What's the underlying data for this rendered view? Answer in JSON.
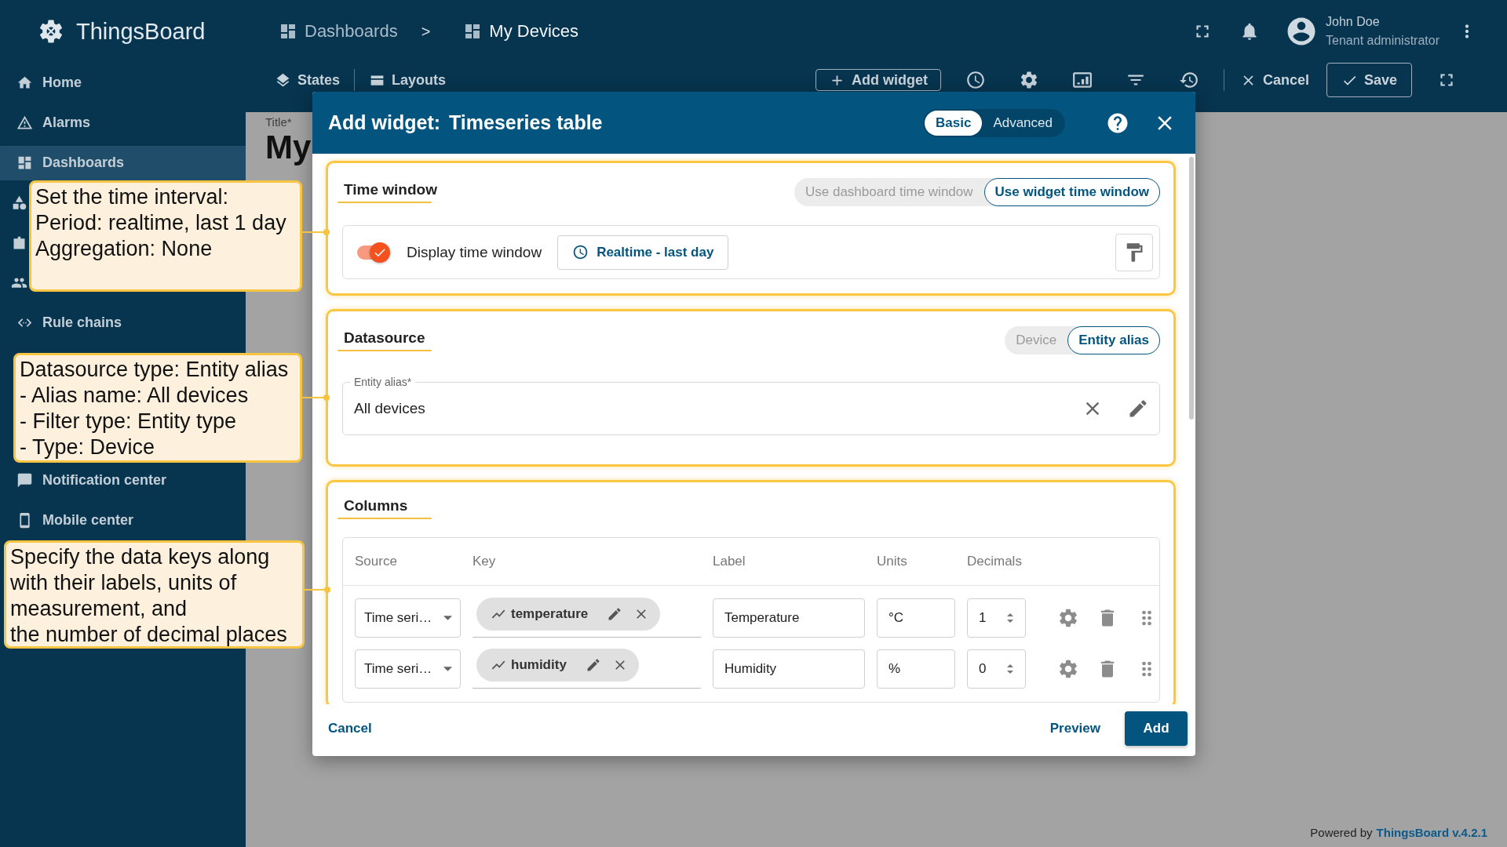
{
  "header": {
    "logo": "ThingsBoard",
    "breadcrumb": [
      {
        "label": "Dashboards"
      },
      {
        "label": "My Devices"
      }
    ],
    "separator": ">",
    "user": {
      "name": "John Doe",
      "role": "Tenant administrator"
    }
  },
  "sidebar": {
    "items": [
      {
        "label": "Home",
        "selected": false
      },
      {
        "label": "Alarms",
        "selected": false
      },
      {
        "label": "Dashboards",
        "selected": true
      },
      {
        "selected": false
      },
      {
        "selected": false
      },
      {
        "selected": false
      },
      {
        "label": "Rule chains",
        "selected": false
      },
      {
        "label": "Notification center",
        "selected": false
      },
      {
        "label": "Mobile center",
        "selected": false
      }
    ]
  },
  "toolbar": {
    "states": "States",
    "layouts": "Layouts",
    "add_widget": "Add widget",
    "cancel": "Cancel",
    "save": "Save"
  },
  "dashboard": {
    "title_label": "Title*",
    "title_value": "My"
  },
  "dialog": {
    "title": "Add widget:",
    "widget": "Timeseries table",
    "modes": [
      {
        "label": "Basic",
        "selected": true
      },
      {
        "label": "Advanced",
        "selected": false
      }
    ],
    "time_window": {
      "title": "Time window",
      "options": [
        {
          "label": "Use dashboard time window",
          "selected": false
        },
        {
          "label": "Use widget time window",
          "selected": true
        }
      ],
      "display": {
        "label": "Display time window",
        "on": true
      },
      "interval": "Realtime - last day"
    },
    "datasource": {
      "title": "Datasource",
      "options": [
        {
          "label": "Device",
          "selected": false
        },
        {
          "label": "Entity alias",
          "selected": true
        }
      ],
      "field": {
        "label": "Entity alias*",
        "value": "All devices"
      }
    },
    "columns": {
      "title": "Columns",
      "headers": [
        "Source",
        "Key",
        "Label",
        "Units",
        "Decimals"
      ],
      "rows": [
        {
          "source": "Time seri…",
          "key": "temperature",
          "label": "Temperature",
          "units": "°C",
          "decimals": "1"
        },
        {
          "source": "Time seri…",
          "key": "humidity",
          "label": "Humidity",
          "units": "%",
          "decimals": "0"
        }
      ]
    },
    "cancel": "Cancel",
    "preview": "Preview",
    "add": "Add"
  },
  "callouts": [
    {
      "text": "Set the time interval:\nPeriod: realtime, last 1 day\nAggregation: None"
    },
    {
      "text": "Datasource type: Entity alias\n- Alias name: All devices\n- Filter type: Entity type\n- Type: Device"
    },
    {
      "text": "Specify the data keys along\nwith their labels, units of\nmeasurement, and\nthe number of decimal places"
    }
  ],
  "footer": {
    "powered_by": "Powered by",
    "link": "ThingsBoard v.4.2.1"
  }
}
